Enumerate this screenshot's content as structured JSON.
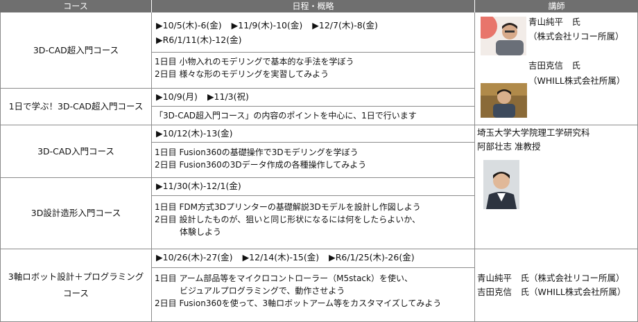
{
  "header": {
    "course": "コース",
    "schedule": "日程・概略",
    "instructor": "講師"
  },
  "rows": [
    {
      "course": "3D-CAD超入門コース",
      "dates_line1": [
        "▶10/5(木)-6(金)",
        "▶11/9(木)-10(金)",
        "▶12/7(木)-8(金)"
      ],
      "dates_line2": [
        "▶R6/1/11(木)-12(金)"
      ],
      "desc": [
        "1日目 小物入れのモデリングで基本的な手法を学ぼう",
        "2日目 様々な形のモデリングを実習してみよう"
      ]
    },
    {
      "course": "1日で学ぶ！3D-CAD超入門コース",
      "dates_line1": [
        "▶10/9(月)",
        "▶11/3(祝)"
      ],
      "desc": [
        "「3D-CAD超入門コース」の内容のポイントを中心に、1日で行います"
      ]
    },
    {
      "course": "3D-CAD入門コース",
      "dates_line1": [
        "▶10/12(木)-13(金)"
      ],
      "desc": [
        "1日目 Fusion360の基礎操作で3Dモデリングを学ぼう",
        "2日目 Fusion360の3Dデータ作成の各種操作してみよう"
      ]
    },
    {
      "course": "3D設計造形入門コース",
      "dates_line1": [
        "▶11/30(木)-12/1(金)"
      ],
      "desc": [
        "1日目 FDM方式3Dプリンターの基礎解説3Dモデルを設計し作図しよう",
        "2日目 設計したものが、狙いと同じ形状になるには何をしたらよいか、",
        "　　　体験しよう"
      ]
    },
    {
      "course_line1": "3軸ロボット設計＋プログラミング",
      "course_line2": "コース",
      "dates_line1": [
        "▶10/26(木)-27(金)",
        "▶12/14(木)-15(金)",
        "▶R6/1/25(木)-26(金)"
      ],
      "desc": [
        "1日目 アーム部品等をマイクロコントローラー（M5stack）を使い、",
        "　　　ビジュアルプログラミングで、動作させよう",
        "2日目 Fusion360を使って、3軸ロボットアーム等をカスタマイズしてみよう"
      ]
    }
  ],
  "instructors": {
    "group1": {
      "name1": "青山純平　氏",
      "org1": "（株式会社リコー所属）",
      "name2": "吉田克信　氏",
      "org2": "（WHILL株式会社所属）"
    },
    "group2": {
      "affiliation": "埼玉大学大学院理工学研究科",
      "name": "阿部壮志 准教授"
    },
    "group3": {
      "line1": "青山純平　氏（株式会社リコー所属）",
      "line2": "吉田克信　氏（WHILL株式会社所属）"
    }
  },
  "colors": {
    "header_bg": "#6f6f6f",
    "grid": "#8a8a8a"
  }
}
